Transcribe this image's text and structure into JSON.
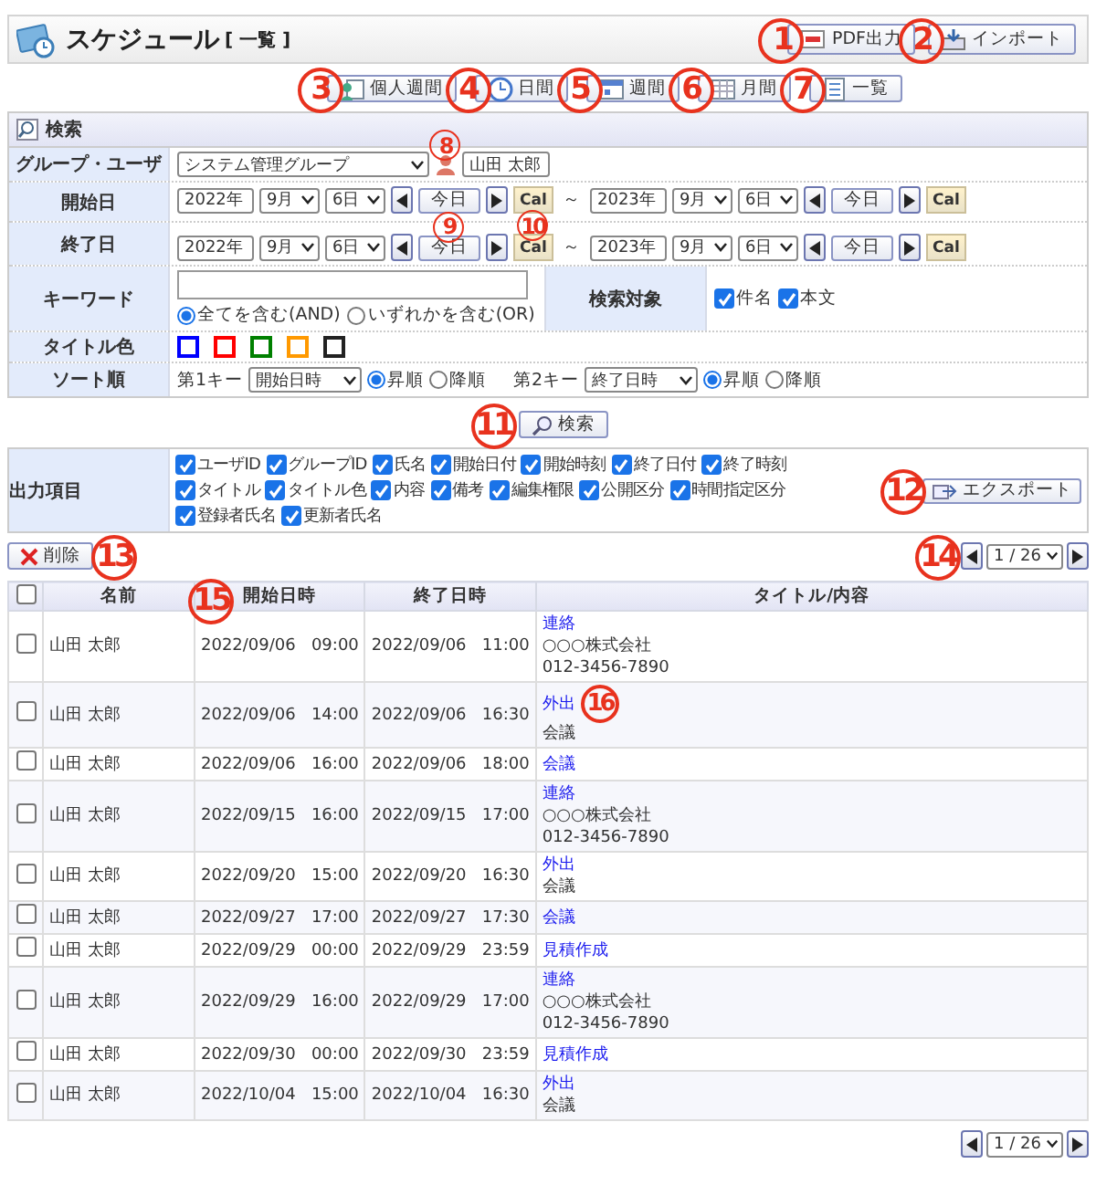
{
  "header": {
    "title": "スケジュール",
    "subtitle": "[ 一覧 ]",
    "buttons": [
      {
        "kind": "pdf",
        "label": "PDF出力",
        "callout": "1"
      },
      {
        "kind": "import",
        "label": "インポート",
        "callout": "2"
      }
    ]
  },
  "view_buttons": [
    {
      "kind": "personal-week",
      "label": "個人週間",
      "callout": "3"
    },
    {
      "kind": "day",
      "label": "日間",
      "callout": "4"
    },
    {
      "kind": "week",
      "label": "週間",
      "callout": "5"
    },
    {
      "kind": "month",
      "label": "月間",
      "callout": "6"
    },
    {
      "kind": "list",
      "label": "一覧",
      "callout": "7"
    }
  ],
  "search": {
    "title": "検索",
    "group_user": {
      "label": "グループ・ユーザ",
      "group": "システム管理グループ",
      "user": "山田 太郎",
      "callout": "8"
    },
    "date_rows": [
      {
        "label": "開始日",
        "separator": "～",
        "from": {
          "year": "2022年",
          "month": "9月",
          "day": "6日",
          "today": "今日",
          "cal": "Cal"
        },
        "to": {
          "year": "2023年",
          "month": "9月",
          "day": "6日",
          "today": "今日",
          "cal": "Cal"
        }
      },
      {
        "label": "終了日",
        "separator": "～",
        "from": {
          "year": "2022年",
          "month": "9月",
          "day": "6日",
          "today": "今日",
          "today_callout": "9",
          "cal": "Cal",
          "cal_callout": "10"
        },
        "to": {
          "year": "2023年",
          "month": "9月",
          "day": "6日",
          "today": "今日",
          "cal": "Cal"
        }
      }
    ],
    "keyword": {
      "label": "キーワード",
      "modes": [
        {
          "label": "全てを含む(AND)",
          "selected": true
        },
        {
          "label": "いずれかを含む(OR)",
          "selected": false
        }
      ]
    },
    "target": {
      "label": "検索対象",
      "options": [
        {
          "label": "件名",
          "checked": true
        },
        {
          "label": "本文",
          "checked": true
        }
      ]
    },
    "title_color": {
      "label": "タイトル色",
      "colors": [
        {
          "color": "#0000ff"
        },
        {
          "color": "#ff0000"
        },
        {
          "color": "#008000"
        },
        {
          "color": "#ff9900"
        },
        {
          "color": "#222222"
        }
      ]
    },
    "sort": {
      "label": "ソート順",
      "keys": [
        {
          "label": "第1キー",
          "value": "開始日時",
          "orders": [
            {
              "label": "昇順",
              "selected": true
            },
            {
              "label": "降順",
              "selected": false
            }
          ]
        },
        {
          "label": "第2キー",
          "value": "終了日時",
          "orders": [
            {
              "label": "昇順",
              "selected": true
            },
            {
              "label": "降順",
              "selected": false
            }
          ]
        }
      ]
    },
    "button": {
      "label": "検索",
      "callout": "11"
    }
  },
  "output": {
    "label": "出力項目",
    "items": [
      {
        "label": "ユーザID",
        "checked": true
      },
      {
        "label": "グループID",
        "checked": true
      },
      {
        "label": "氏名",
        "checked": true
      },
      {
        "label": "開始日付",
        "checked": true
      },
      {
        "label": "開始時刻",
        "checked": true
      },
      {
        "label": "終了日付",
        "checked": true
      },
      {
        "label": "終了時刻",
        "checked": true
      },
      {
        "label": "タイトル",
        "checked": true
      },
      {
        "label": "タイトル色",
        "checked": true
      },
      {
        "label": "内容",
        "checked": true
      },
      {
        "label": "備考",
        "checked": true
      },
      {
        "label": "編集権限",
        "checked": true
      },
      {
        "label": "公開区分",
        "checked": true
      },
      {
        "label": "時間指定区分",
        "checked": true
      },
      {
        "label": "登録者氏名",
        "checked": true
      },
      {
        "label": "更新者氏名",
        "checked": true
      }
    ],
    "export": {
      "label": "エクスポート",
      "callout": "12"
    }
  },
  "delete_button": {
    "label": "削除",
    "callout": "13"
  },
  "pager_top": {
    "page": "1 / 26",
    "callout": "14"
  },
  "table": {
    "select_all": {
      "checked": false
    },
    "columns": [
      {
        "label": "名前"
      },
      {
        "label": "開始日時",
        "callout": "15"
      },
      {
        "label": "終了日時"
      },
      {
        "label": "タイトル/内容"
      }
    ],
    "rows": [
      {
        "checked": false,
        "name": "山田 太郎",
        "start": "2022/09/06   09:00",
        "end": "2022/09/06   11:00",
        "title": "連絡",
        "details": [
          "○○○株式会社",
          "012-3456-7890"
        ]
      },
      {
        "checked": false,
        "name": "山田 太郎",
        "start": "2022/09/06   14:00",
        "end": "2022/09/06   16:30",
        "title": "外出",
        "details": [
          "会議"
        ],
        "callout": "16"
      },
      {
        "checked": false,
        "name": "山田 太郎",
        "start": "2022/09/06   16:00",
        "end": "2022/09/06   18:00",
        "title": "会議"
      },
      {
        "checked": false,
        "name": "山田 太郎",
        "start": "2022/09/15   16:00",
        "end": "2022/09/15   17:00",
        "title": "連絡",
        "details": [
          "○○○株式会社",
          "012-3456-7890"
        ]
      },
      {
        "checked": false,
        "name": "山田 太郎",
        "start": "2022/09/20   15:00",
        "end": "2022/09/20   16:30",
        "title": "外出",
        "details": [
          "会議"
        ]
      },
      {
        "checked": false,
        "name": "山田 太郎",
        "start": "2022/09/27   17:00",
        "end": "2022/09/27   17:30",
        "title": "会議"
      },
      {
        "checked": false,
        "name": "山田 太郎",
        "start": "2022/09/29   00:00",
        "end": "2022/09/29   23:59",
        "title": "見積作成"
      },
      {
        "checked": false,
        "name": "山田 太郎",
        "start": "2022/09/29   16:00",
        "end": "2022/09/29   17:00",
        "title": "連絡",
        "details": [
          "○○○株式会社",
          "012-3456-7890"
        ]
      },
      {
        "checked": false,
        "name": "山田 太郎",
        "start": "2022/09/30   00:00",
        "end": "2022/09/30   23:59",
        "title": "見積作成"
      },
      {
        "checked": false,
        "name": "山田 太郎",
        "start": "2022/10/04   15:00",
        "end": "2022/10/04   16:30",
        "title": "外出",
        "details": [
          "会議"
        ]
      }
    ]
  },
  "pager_bottom": {
    "page": "1 / 26"
  }
}
